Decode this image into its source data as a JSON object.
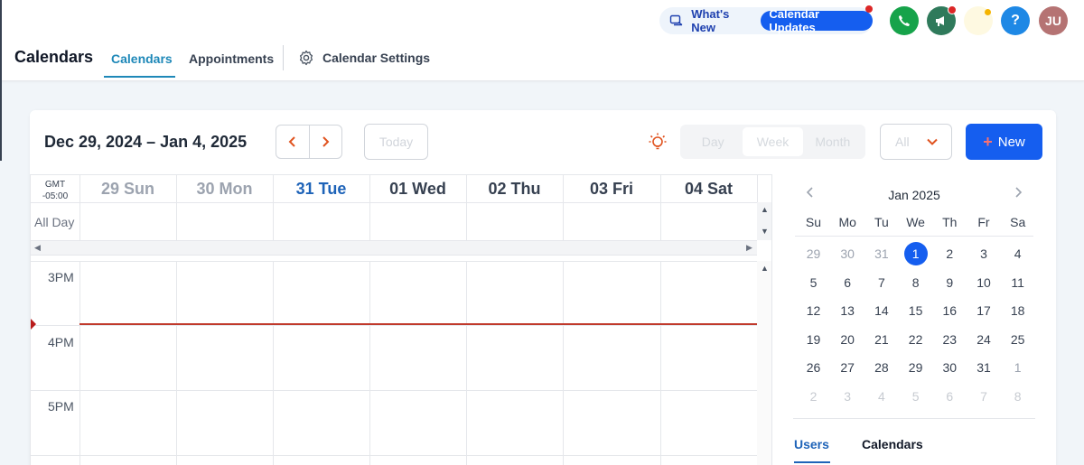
{
  "header": {
    "whats_new": "What's New",
    "calendar_updates": "Calendar Updates",
    "help_label": "?",
    "avatar_initials": "JU"
  },
  "nav": {
    "title": "Calendars",
    "tabs": [
      {
        "label": "Calendars",
        "active": true
      },
      {
        "label": "Appointments",
        "active": false
      }
    ],
    "settings_label": "Calendar Settings"
  },
  "toolbar": {
    "date_range": "Dec 29, 2024 – Jan 4, 2025",
    "today_label": "Today",
    "views": [
      "Day",
      "Week",
      "Month"
    ],
    "active_view": "Week",
    "filter_value": "All",
    "new_label": "New"
  },
  "week": {
    "timezone_line1": "GMT",
    "timezone_line2": "-05:00",
    "days": [
      {
        "label": "29 Sun",
        "state": "past"
      },
      {
        "label": "30 Mon",
        "state": "past"
      },
      {
        "label": "31 Tue",
        "state": "today"
      },
      {
        "label": "01 Wed",
        "state": "future"
      },
      {
        "label": "02 Thu",
        "state": "future"
      },
      {
        "label": "03 Fri",
        "state": "future"
      },
      {
        "label": "04 Sat",
        "state": "future"
      }
    ],
    "all_day_label": "All Day",
    "hours": [
      "3PM",
      "4PM",
      "5PM"
    ]
  },
  "mini_calendar": {
    "title": "Jan 2025",
    "weekdays": [
      "Su",
      "Mo",
      "Tu",
      "We",
      "Th",
      "Fr",
      "Sa"
    ],
    "weeks": [
      [
        {
          "d": "29",
          "s": "muted"
        },
        {
          "d": "30",
          "s": "muted"
        },
        {
          "d": "31",
          "s": "muted"
        },
        {
          "d": "1",
          "s": "today"
        },
        {
          "d": "2",
          "s": ""
        },
        {
          "d": "3",
          "s": ""
        },
        {
          "d": "4",
          "s": ""
        }
      ],
      [
        {
          "d": "5",
          "s": ""
        },
        {
          "d": "6",
          "s": ""
        },
        {
          "d": "7",
          "s": ""
        },
        {
          "d": "8",
          "s": ""
        },
        {
          "d": "9",
          "s": ""
        },
        {
          "d": "10",
          "s": ""
        },
        {
          "d": "11",
          "s": ""
        }
      ],
      [
        {
          "d": "12",
          "s": ""
        },
        {
          "d": "13",
          "s": ""
        },
        {
          "d": "14",
          "s": ""
        },
        {
          "d": "15",
          "s": ""
        },
        {
          "d": "16",
          "s": ""
        },
        {
          "d": "17",
          "s": ""
        },
        {
          "d": "18",
          "s": ""
        }
      ],
      [
        {
          "d": "19",
          "s": ""
        },
        {
          "d": "20",
          "s": ""
        },
        {
          "d": "21",
          "s": ""
        },
        {
          "d": "22",
          "s": ""
        },
        {
          "d": "23",
          "s": ""
        },
        {
          "d": "24",
          "s": ""
        },
        {
          "d": "25",
          "s": ""
        }
      ],
      [
        {
          "d": "26",
          "s": ""
        },
        {
          "d": "27",
          "s": ""
        },
        {
          "d": "28",
          "s": ""
        },
        {
          "d": "29",
          "s": ""
        },
        {
          "d": "30",
          "s": ""
        },
        {
          "d": "31",
          "s": ""
        },
        {
          "d": "1",
          "s": "muted"
        }
      ],
      [
        {
          "d": "2",
          "s": "dim"
        },
        {
          "d": "3",
          "s": "dim"
        },
        {
          "d": "4",
          "s": "dim"
        },
        {
          "d": "5",
          "s": "dim"
        },
        {
          "d": "6",
          "s": "dim"
        },
        {
          "d": "7",
          "s": "dim"
        },
        {
          "d": "8",
          "s": "dim"
        }
      ]
    ]
  },
  "side_tabs": [
    {
      "label": "Users",
      "active": true
    },
    {
      "label": "Calendars",
      "active": false
    }
  ],
  "colors": {
    "primary": "#155eef",
    "today_text": "#1e63b8",
    "now_line": "#c0392b"
  }
}
